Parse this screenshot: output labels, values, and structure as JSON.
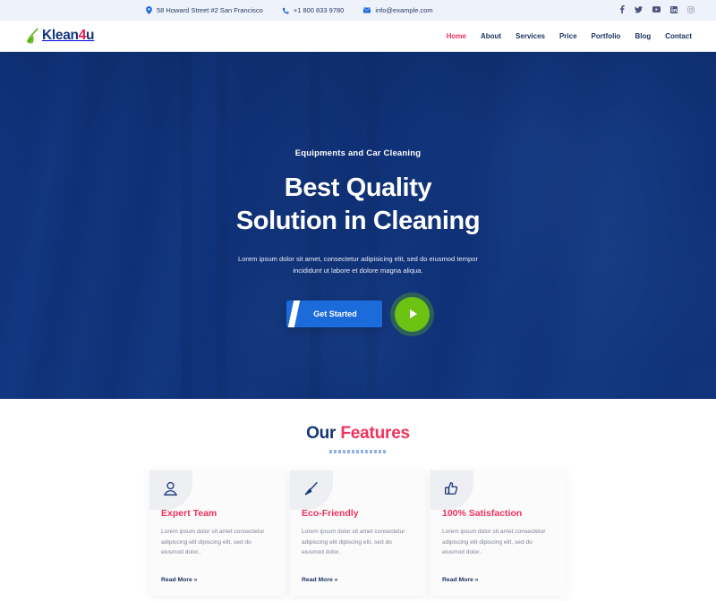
{
  "topbar": {
    "address": "58 Howard Street #2 San Francisco",
    "phone": "+1 800 833 9780",
    "email": "info@example.com",
    "socials": [
      {
        "name": "facebook-icon",
        "label": "f"
      },
      {
        "name": "twitter-icon",
        "label": "t"
      },
      {
        "name": "youtube-icon",
        "label": "yt"
      },
      {
        "name": "linkedin-icon",
        "label": "in"
      },
      {
        "name": "instagram-icon",
        "label": "ig"
      }
    ]
  },
  "brand": {
    "name_main": "Klean",
    "name_accent": "4",
    "name_tail": "u",
    "icon": "broom-icon",
    "colors": {
      "main": "#15357a",
      "accent": "#e8174a",
      "broom": "#5fae20"
    }
  },
  "nav": {
    "items": [
      {
        "label": "Home",
        "active": true
      },
      {
        "label": "About",
        "active": false
      },
      {
        "label": "Services",
        "active": false
      },
      {
        "label": "Price",
        "active": false
      },
      {
        "label": "Portfolio",
        "active": false
      },
      {
        "label": "Blog",
        "active": false
      },
      {
        "label": "Contact",
        "active": false
      }
    ],
    "active_color": "#f0325c",
    "idle_color": "#17315e"
  },
  "hero": {
    "eyebrow": "Equipments and Car Cleaning",
    "title_line1": "Best Quality",
    "title_line2": "Solution in Cleaning",
    "subtitle": "Lorem ipsum dolor sit amet, consectetur adipisicing elit, sed do eiusmod tempor incididunt ut labore et dolore magna aliqua.",
    "cta_label": "Get Started",
    "play_label": "play-icon",
    "bg_color": "#1b4b9b",
    "cta_color": "#1b6bdb",
    "play_color": "#6cc311"
  },
  "features": {
    "title_prefix": "Our ",
    "title_accent": "Features",
    "cards": [
      {
        "icon": "user-icon",
        "title": "Expert Team",
        "body": "Lorem ipsum dolor sit amet consectetur adipiscing elit dipiscing elit, sed do eiusmod dolor..",
        "link": "Read More »"
      },
      {
        "icon": "brush-icon",
        "title": "Eco-Friendly",
        "body": "Lorem ipsum dolor sit amet consectetur adipiscing elit dipiscing elit, sed do eiusmod dolor..",
        "link": "Read More »"
      },
      {
        "icon": "thumbs-up-icon",
        "title": "100% Satisfaction",
        "body": "Lorem ipsum dolor sit amet consectetur adipiscing elit dipiscing elit, sed do eiusmod dolor..",
        "link": "Read More »"
      }
    ]
  }
}
